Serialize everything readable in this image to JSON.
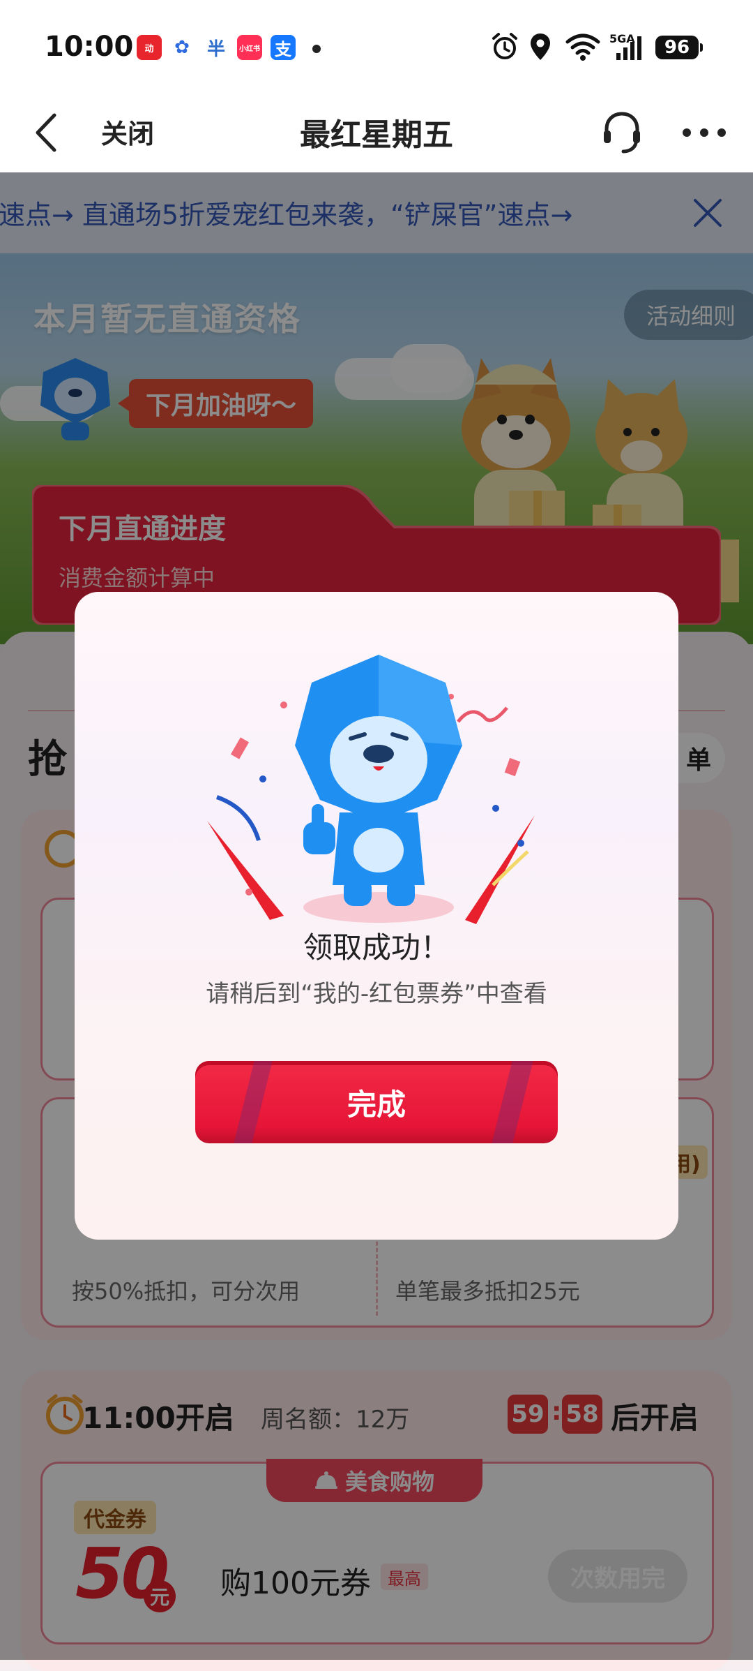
{
  "status_bar": {
    "time": "10:00",
    "network": "5GA",
    "battery": "96"
  },
  "navbar": {
    "close_label": "关闭",
    "title": "最红星期五"
  },
  "banner": {
    "text": "速点→   直通场5折爱宠红包来袭，“铲屎官”速点→"
  },
  "hero": {
    "title": "本月暂无直通资格",
    "rules_button": "活动细则",
    "encourage_bubble": "下月加油呀～",
    "progress_title": "下月直通进度",
    "progress_status": "消费金额计算中"
  },
  "section": {
    "title": "抢",
    "pill": "单"
  },
  "block1": {
    "coupon_left_desc": "按50%抵扣，可分次用",
    "coupon_right_desc": "单笔最多抵扣25元",
    "badge_partial": "用)"
  },
  "block2": {
    "time_label": "11:00开启",
    "quota": "周名额：12万",
    "countdown_minutes": "59",
    "countdown_seconds": "58",
    "countdown_suffix": "后开启",
    "category": "美食购物",
    "voucher_type": "代金券",
    "voucher_amount": "50",
    "voucher_unit": "元",
    "voucher_name": "购100元券",
    "voucher_tag": "最高",
    "voucher_button": "次数用完"
  },
  "modal": {
    "title": "领取成功！",
    "subtitle": "请稍后到“我的-红包票券”中查看",
    "confirm_button": "完成"
  },
  "colors": {
    "brand_red": "#e61537",
    "banner_blue": "#3458b8"
  }
}
